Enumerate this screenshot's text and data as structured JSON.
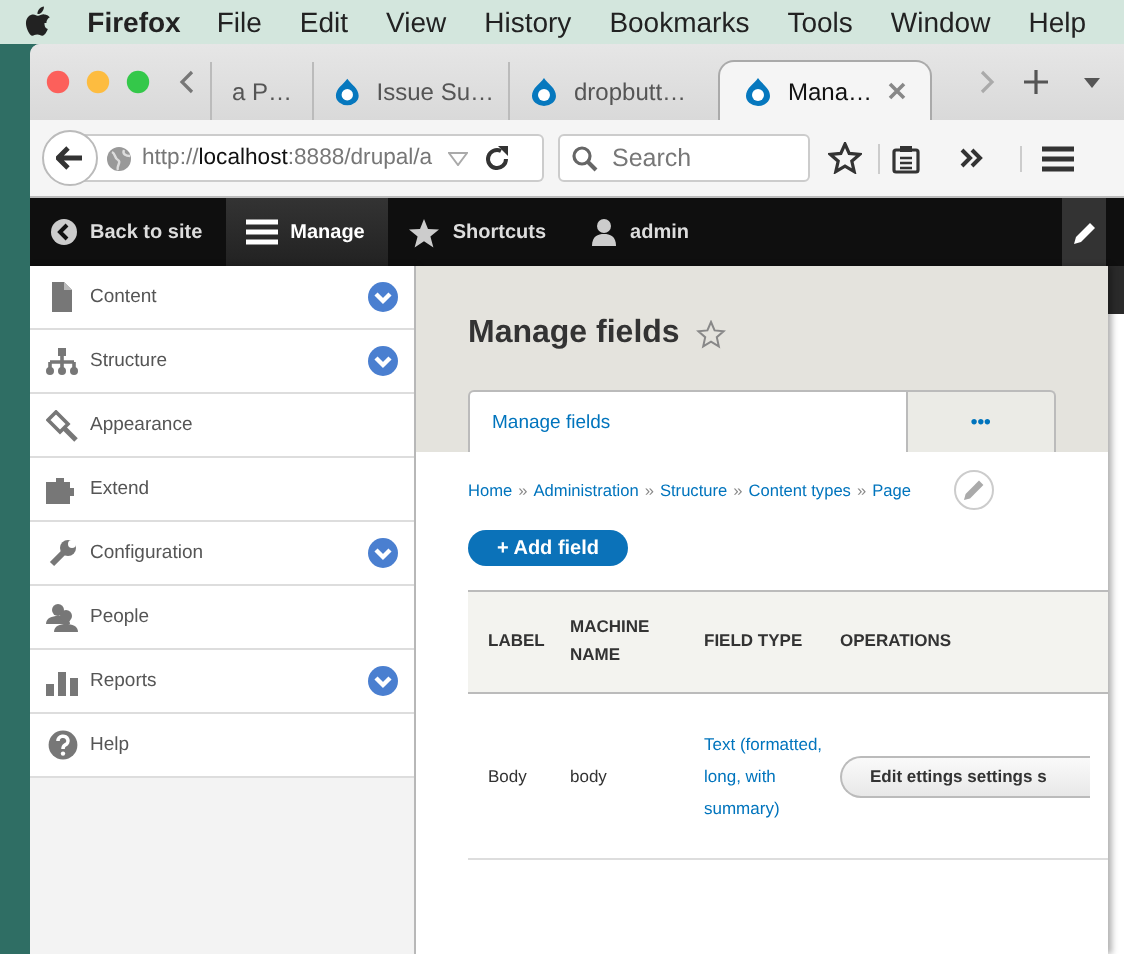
{
  "menu_bar": {
    "app": "Firefox",
    "items": [
      "File",
      "Edit",
      "View",
      "History",
      "Bookmarks",
      "Tools",
      "Window",
      "Help"
    ]
  },
  "browser": {
    "tabs": [
      {
        "title": "a P…",
        "selected": false
      },
      {
        "title": "Issue Su…",
        "selected": false
      },
      {
        "title": "dropbutt…",
        "selected": false
      },
      {
        "title": "Mana…",
        "selected": true
      }
    ],
    "url": {
      "scheme": "http://",
      "host": "localhost",
      "rest": ":8888/drupal/a"
    },
    "search": {
      "placeholder": "Search"
    }
  },
  "toolbar": {
    "items": [
      {
        "label": "Back to site",
        "selected": false
      },
      {
        "label": "Manage",
        "selected": true
      },
      {
        "label": "Shortcuts",
        "selected": false
      },
      {
        "label": "admin",
        "selected": false
      }
    ]
  },
  "sidebar": {
    "items": [
      {
        "label": "Content",
        "has_children": true
      },
      {
        "label": "Structure",
        "has_children": true
      },
      {
        "label": "Appearance",
        "has_children": false
      },
      {
        "label": "Extend",
        "has_children": false
      },
      {
        "label": "Configuration",
        "has_children": true
      },
      {
        "label": "People",
        "has_children": false
      },
      {
        "label": "Reports",
        "has_children": true
      },
      {
        "label": "Help",
        "has_children": false
      }
    ]
  },
  "page": {
    "title": "Manage fields",
    "tabs": [
      {
        "label": "Manage fields",
        "selected": true
      },
      {
        "label": "•••",
        "selected": false
      }
    ],
    "breadcrumb": [
      "Home",
      "Administration",
      "Structure",
      "Content types",
      "Page"
    ],
    "breadcrumb_separator": "»",
    "add_button": "+ Add field",
    "table": {
      "columns": [
        "LABEL",
        "MACHINE NAME",
        "FIELD TYPE",
        "OPERATIONS"
      ],
      "rows": [
        {
          "label": "Body",
          "machine_name": "body",
          "field_type": "Text (formatted, long, with summary)",
          "operations": "Edit ettings settings s"
        }
      ]
    }
  }
}
